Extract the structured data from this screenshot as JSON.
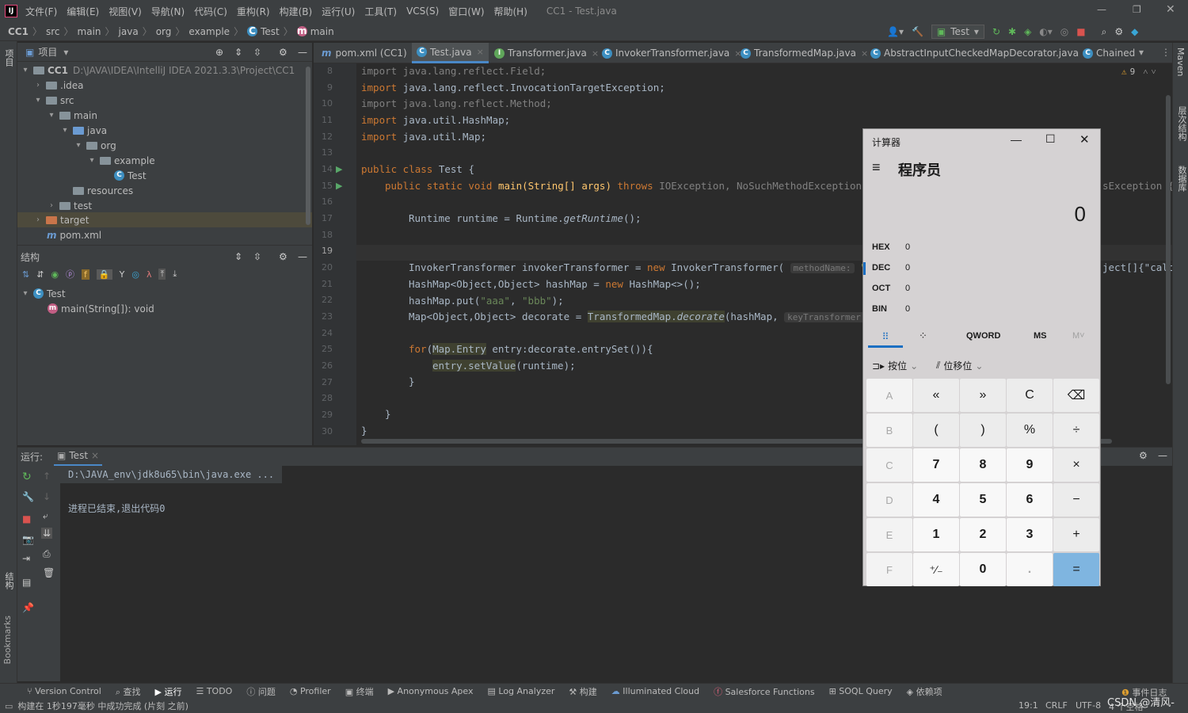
{
  "menubar": {
    "items": [
      "文件(F)",
      "编辑(E)",
      "视图(V)",
      "导航(N)",
      "代码(C)",
      "重构(R)",
      "构建(B)",
      "运行(U)",
      "工具(T)",
      "VCS(S)",
      "窗口(W)",
      "帮助(H)"
    ],
    "title": "CC1 - Test.java"
  },
  "breadcrumb": {
    "items": [
      "CC1",
      "src",
      "main",
      "java",
      "org",
      "example",
      "Test",
      "main"
    ],
    "run_config": "Test"
  },
  "project_panel": {
    "title": "项目",
    "root": "CC1",
    "root_path": "D:\\JAVA\\IDEA\\IntelliJ IDEA 2021.3.3\\Project\\CC1",
    "nodes": [
      ".idea",
      "src",
      "main",
      "java",
      "org",
      "example",
      "Test",
      "resources",
      "test",
      "target",
      "pom.xml"
    ]
  },
  "structure_panel": {
    "title": "结构",
    "class": "Test",
    "method": "main(String[]): void"
  },
  "tabs": [
    "pom.xml (CC1)",
    "Test.java",
    "Transformer.java",
    "InvokerTransformer.java",
    "TransformedMap.java",
    "AbstractInputCheckedMapDecorator.java",
    "Chained"
  ],
  "editor": {
    "warnings": "9",
    "line_numbers": [
      "8",
      "9",
      "10",
      "11",
      "12",
      "13",
      "14",
      "15",
      "16",
      "17",
      "18",
      "19",
      "20",
      "21",
      "22",
      "23",
      "24",
      "25",
      "26",
      "27",
      "28",
      "29",
      "30"
    ],
    "lines": {
      "l8a": "import ",
      "l8b": "java.lang.reflect.Field;",
      "l9a": "import ",
      "l9b": "java.lang.reflect.InvocationTargetException;",
      "l10": "import java.lang.reflect.Method;",
      "l11a": "import ",
      "l11b": "java.util.HashMap;",
      "l12a": "import ",
      "l12b": "java.util.Map;",
      "l14a": "public class ",
      "l14b": "Test {",
      "l15a": "public static void ",
      "l15b": "main(String[] args) ",
      "l15c": "throws ",
      "l15d": "IOException, NoSuchMethodException, ",
      "l15e": "sException {",
      "l17a": "Runtime runtime = Runtime.",
      "l17b": "getRuntime",
      "l17c": "();",
      "l20a": "InvokerTransformer invokerTransformer = ",
      "l20b": "new ",
      "l20c": "InvokerTransformer( ",
      "l20hint": "methodName:",
      "l20d": " \"",
      "l20e": "ject[]{\"calc\"",
      "l21a": "HashMap<Object,Object> hashMap = ",
      "l21b": "new ",
      "l21c": "HashMap<>();",
      "l22a": "hashMap.put(",
      "l22b": "\"aaa\"",
      "l22c": ", ",
      "l22d": "\"bbb\"",
      "l22e": ");",
      "l23a": "Map<Object,Object> decorate = ",
      "l23b": "TransformedMap.",
      "l23c": "decorate",
      "l23d": "(hashMap, ",
      "l23hint": "keyTransformer:",
      "l25a": "for",
      "l25b": "(",
      "l25c": "Map.Entry",
      "l25d": " entry:decorate.entrySet()){",
      "l26a": "entry.setValue",
      "l26b": "(runtime);",
      "l27": "}",
      "l29": "}",
      "l30": "}"
    }
  },
  "run_panel": {
    "label": "运行:",
    "tab": "Test",
    "cmd": "D:\\JAVA_env\\jdk8u65\\bin\\java.exe ...",
    "output": "进程已结束,退出代码0"
  },
  "bottom_tools": [
    "Version Control",
    "查找",
    "运行",
    "TODO",
    "问题",
    "Profiler",
    "终端",
    "Anonymous Apex",
    "Log Analyzer",
    "构建",
    "Illuminated Cloud",
    "Salesforce Functions",
    "SOQL Query",
    "依赖项"
  ],
  "event_log": "事件日志",
  "status": {
    "message": "构建在 1秒197毫秒 中成功完成 (片刻 之前)",
    "pos": "19:1",
    "eol": "CRLF",
    "enc": "UTF-8",
    "indent": "4 个空格",
    "watermark": "CSDN @清风-"
  },
  "right_stripe": [
    "Maven",
    "层次结构",
    "数据库"
  ],
  "left_stripe": [
    "项目",
    "结构",
    "Bookmarks"
  ],
  "calculator": {
    "title": "计算器",
    "mode": "程序员",
    "display": "0",
    "radix": [
      {
        "label": "HEX",
        "value": "0"
      },
      {
        "label": "DEC",
        "value": "0"
      },
      {
        "label": "OCT",
        "value": "0"
      },
      {
        "label": "BIN",
        "value": "0"
      }
    ],
    "word": "QWORD",
    "ms": "MS",
    "mplus": "M˅",
    "bitwise": "按位",
    "bitshift": "位移位",
    "keys": [
      [
        "A",
        "«",
        "»",
        "C",
        "⌫"
      ],
      [
        "B",
        "(",
        ")",
        "%",
        "÷"
      ],
      [
        "C",
        "7",
        "8",
        "9",
        "×"
      ],
      [
        "D",
        "4",
        "5",
        "6",
        "−"
      ],
      [
        "E",
        "1",
        "2",
        "3",
        "+"
      ],
      [
        "F",
        "⁺∕₋",
        "0",
        ".",
        "="
      ]
    ]
  }
}
